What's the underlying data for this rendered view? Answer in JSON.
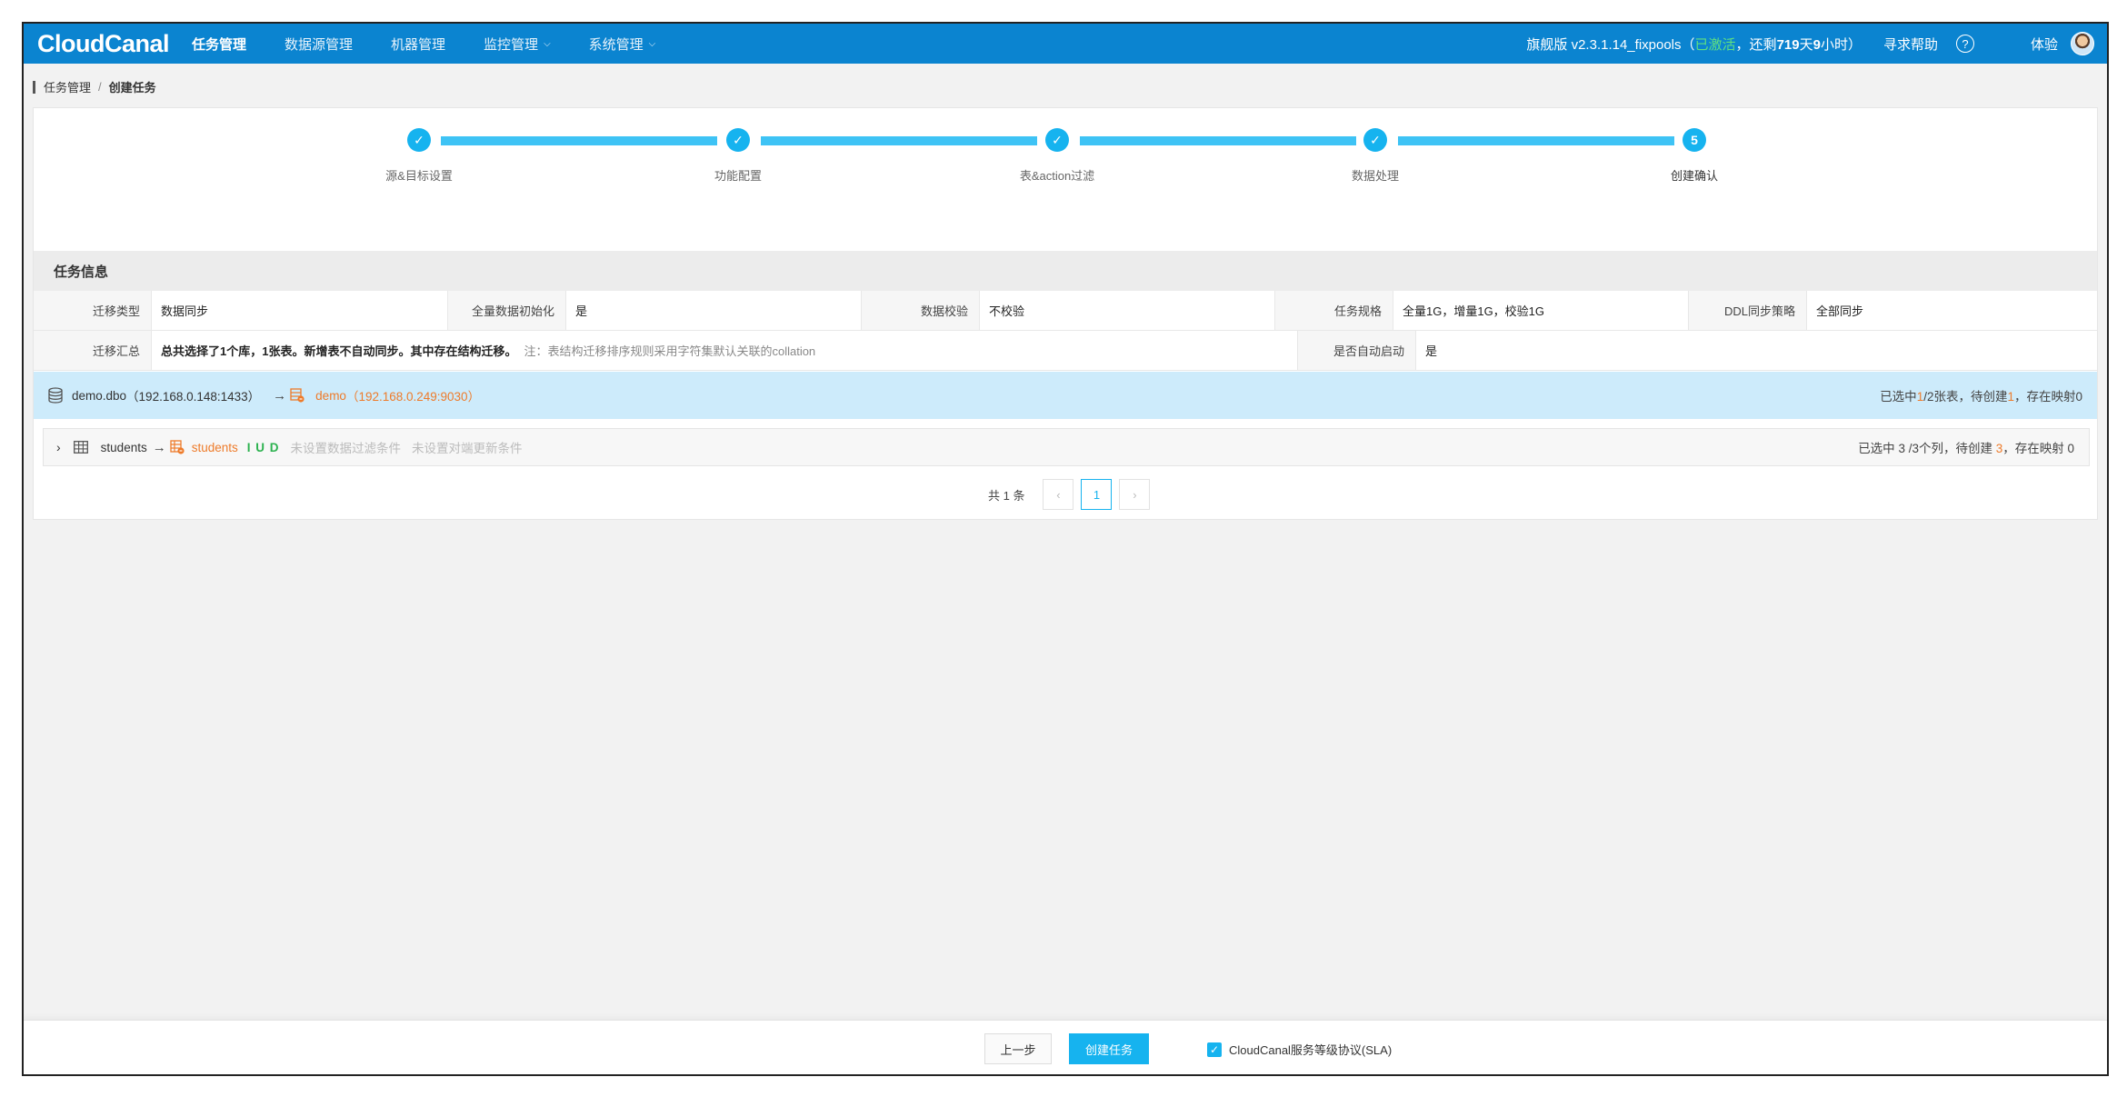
{
  "header": {
    "logo": "CloudCanal",
    "nav": [
      {
        "label": "任务管理",
        "active": true,
        "dropdown": false
      },
      {
        "label": "数据源管理",
        "active": false,
        "dropdown": false
      },
      {
        "label": "机器管理",
        "active": false,
        "dropdown": false
      },
      {
        "label": "监控管理",
        "active": false,
        "dropdown": true
      },
      {
        "label": "系统管理",
        "active": false,
        "dropdown": true
      }
    ],
    "version_prefix": "旗舰版 v2.3.1.14_fixpools",
    "version_open": "（",
    "activated": "已激活",
    "remaining_prefix": "，还剩",
    "remaining_days": "719",
    "day_unit": "天",
    "remaining_hours": "9",
    "hour_unit": "小时）",
    "help": "寻求帮助",
    "help_icon": "?",
    "user": "体验"
  },
  "breadcrumb": {
    "parent": "任务管理",
    "separator": "/",
    "current": "创建任务"
  },
  "steps": [
    {
      "label": "源&目标设置",
      "status": "done"
    },
    {
      "label": "功能配置",
      "status": "done"
    },
    {
      "label": "表&action过滤",
      "status": "done"
    },
    {
      "label": "数据处理",
      "status": "done"
    },
    {
      "label": "创建确认",
      "status": "current",
      "number": "5"
    }
  ],
  "task_info": {
    "title": "任务信息",
    "row1": [
      {
        "label": "迁移类型",
        "value": "数据同步"
      },
      {
        "label": "全量数据初始化",
        "value": "是"
      },
      {
        "label": "数据校验",
        "value": "不校验"
      },
      {
        "label": "任务规格",
        "value": "全量1G，增量1G，校验1G"
      },
      {
        "label": "DDL同步策略",
        "value": "全部同步"
      }
    ],
    "row2": {
      "summary_label": "迁移汇总",
      "summary_value": "总共选择了1个库，1张表。新增表不自动同步。其中存在结构迁移。",
      "summary_note": "注：表结构迁移排序规则采用字符集默认关联的collation",
      "autostart_label": "是否自动启动",
      "autostart_value": "是"
    }
  },
  "db_mapping": {
    "source": "demo.dbo",
    "source_addr": "（192.168.0.148:1433）",
    "arrow": "→",
    "target": "demo",
    "target_addr": "（192.168.0.249:9030）",
    "summary_prefix": "已选中",
    "selected": "1",
    "summary_mid": "/2张表，待创建",
    "to_create": "1",
    "summary_suffix": "，存在映射0"
  },
  "table_mapping": {
    "expand_icon": "›",
    "source": "students",
    "arrow": "→",
    "target": "students",
    "actions": "I U D",
    "filter_hint": "未设置数据过滤条件",
    "update_hint": "未设置对端更新条件",
    "summary_prefix": "已选中 3 /3个列，待创建 ",
    "to_create": "3",
    "summary_suffix": "，存在映射 0"
  },
  "pagination": {
    "total": "共 1 条",
    "prev": "‹",
    "current_page": "1",
    "next": "›"
  },
  "footer": {
    "prev_label": "上一步",
    "create_label": "创建任务",
    "sla_label": "CloudCanal服务等级协议(SLA)",
    "sla_checked": true
  },
  "colors": {
    "nav": "#0b84d0",
    "accent": "#16b3ef",
    "orange": "#ee7b2a",
    "green": "#2cb24f"
  }
}
